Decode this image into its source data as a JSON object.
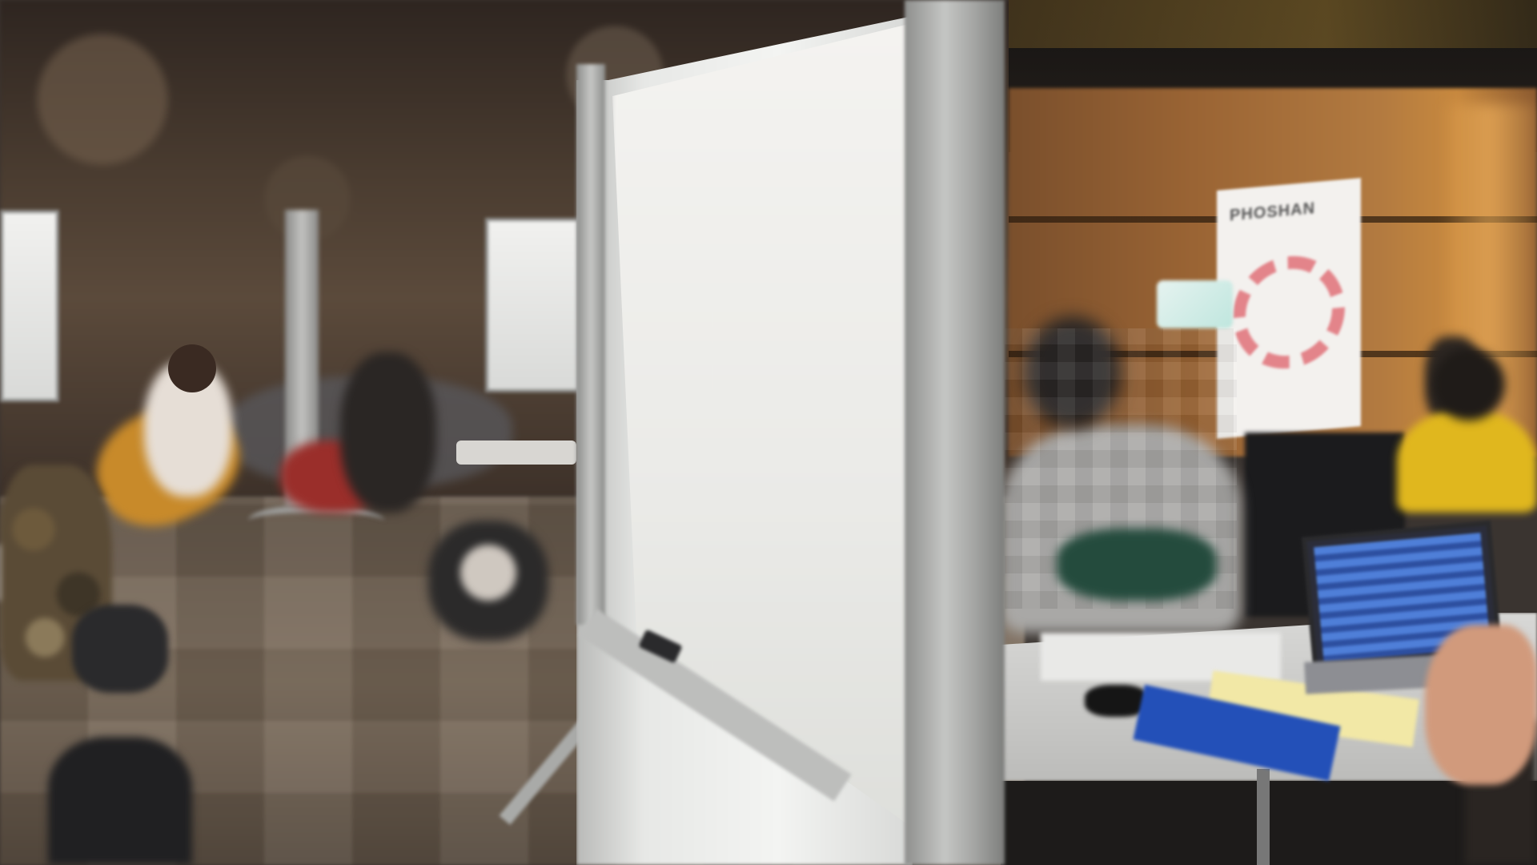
{
  "scene": {
    "banner": {
      "title": "PHOSHAN"
    },
    "colors": {
      "carpet": "#7b6b5a",
      "wood_panel": "#9a6434",
      "whiteboard": "#f3f4f2",
      "yellow_hoodie": "#e0b71e",
      "notebook_blue": "#2350b8",
      "banner_accent": "#e06a72"
    }
  }
}
